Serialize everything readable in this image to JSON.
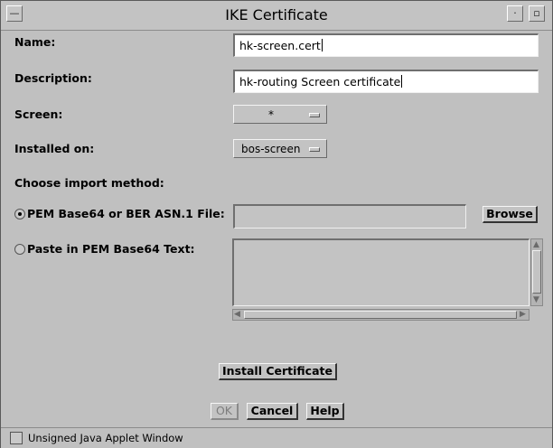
{
  "window": {
    "title": "IKE Certificate",
    "menu_glyph": "—",
    "minimize_glyph": "·",
    "maximize_glyph": "▫"
  },
  "form": {
    "name_label": "Name:",
    "name_value": "hk-screen.cert",
    "description_label": "Description:",
    "description_value": "hk-routing Screen certificate",
    "screen_label": "Screen:",
    "screen_value": "*",
    "installed_label": "Installed on:",
    "installed_value": "bos-screen",
    "import_method_label": "Choose import method:",
    "pem_file_label": "PEM Base64 or BER ASN.1 File:",
    "pem_file_value": "",
    "browse_label": "Browse",
    "paste_label": "Paste in PEM Base64 Text:",
    "paste_value": "",
    "selected_method": "pem_file"
  },
  "actions": {
    "install_label": "Install Certificate",
    "ok_label": "OK",
    "cancel_label": "Cancel",
    "help_label": "Help"
  },
  "status": {
    "text": "Unsigned Java Applet Window"
  }
}
